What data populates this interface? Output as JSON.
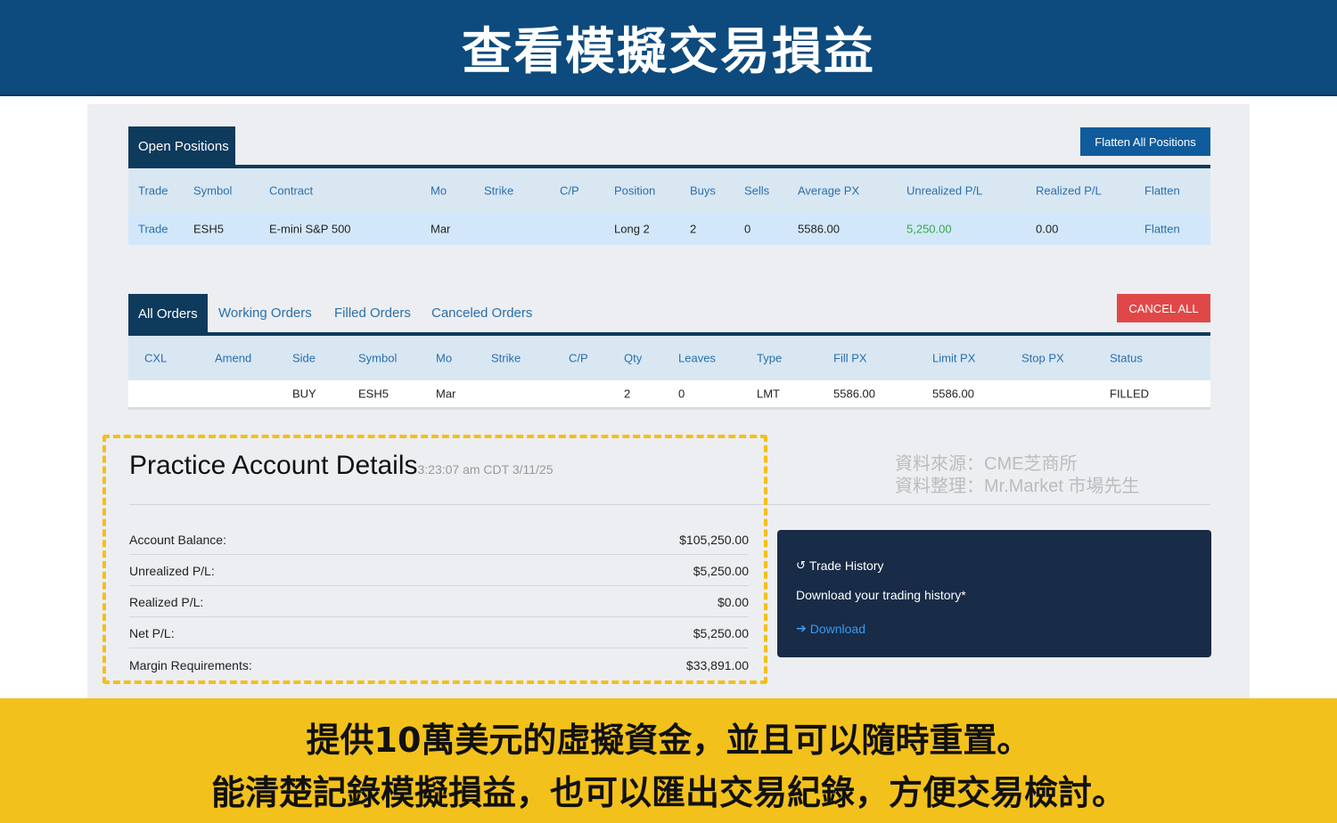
{
  "banner": {
    "title": "查看模擬交易損益"
  },
  "positions": {
    "tab_label": "Open Positions",
    "flatten_all_label": "Flatten All Positions",
    "headers": [
      "Trade",
      "Symbol",
      "Contract",
      "Mo",
      "Strike",
      "C/P",
      "Position",
      "Buys",
      "Sells",
      "Average PX",
      "Unrealized P/L",
      "Realized P/L",
      "Flatten"
    ],
    "row": {
      "trade": "Trade",
      "symbol": "ESH5",
      "contract": "E-mini S&P 500",
      "mo": "Mar",
      "strike": "",
      "cp": "",
      "position": "Long 2",
      "buys": "2",
      "sells": "0",
      "average_px": "5586.00",
      "unrealized": "5,250.00",
      "realized": "0.00",
      "flatten": "Flatten"
    }
  },
  "orders": {
    "tabs": [
      "All Orders",
      "Working Orders",
      "Filled Orders",
      "Canceled Orders"
    ],
    "cancel_all_label": "CANCEL ALL",
    "headers": [
      "CXL",
      "Amend",
      "Side",
      "Symbol",
      "Mo",
      "Strike",
      "C/P",
      "Qty",
      "Leaves",
      "Type",
      "Fill PX",
      "Limit PX",
      "Stop PX",
      "Status"
    ],
    "row": {
      "side": "BUY",
      "symbol": "ESH5",
      "mo": "Mar",
      "qty": "2",
      "leaves": "0",
      "type": "LMT",
      "fill_px": "5586.00",
      "limit_px": "5586.00",
      "status": "FILLED"
    }
  },
  "account": {
    "title": "Practice Account Details",
    "timestamp": "3:23:07 am CDT 3/11/25",
    "rows": [
      {
        "label": "Account Balance:",
        "value": "$105,250.00"
      },
      {
        "label": "Unrealized P/L:",
        "value": "$5,250.00"
      },
      {
        "label": "Realized P/L:",
        "value": "$0.00"
      },
      {
        "label": "Net P/L:",
        "value": "$5,250.00"
      },
      {
        "label": "Margin Requirements:",
        "value": "$33,891.00"
      }
    ]
  },
  "source": {
    "line1": "資料來源：CME芝商所",
    "line2": "資料整理：Mr.Market 市場先生"
  },
  "history": {
    "title": "Trade History",
    "description": "Download your trading history*",
    "download_label": "Download"
  },
  "footer": {
    "line1": "提供10萬美元的虛擬資金，並且可以隨時重置。",
    "line2": "能清楚記錄模擬損益，也可以匯出交易紀錄，方便交易檢討。"
  },
  "colors": {
    "navy": "#0e3a5c",
    "accent_blue": "#2a6fab",
    "profit_green": "#3aa64a",
    "cancel_red": "#e04848",
    "highlight_yellow": "#f5bf17"
  }
}
